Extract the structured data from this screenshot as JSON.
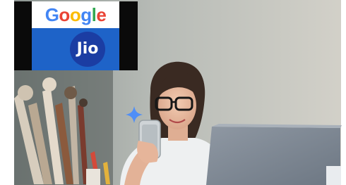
{
  "logo": {
    "google_text": "Google",
    "google_colors": [
      "#4285F4",
      "#EA4335",
      "#FBBC05",
      "#4285F4",
      "#34A853",
      "#EA4335"
    ],
    "jio_text": "Jio",
    "jio_circle_color": "#1b3da3",
    "panel_blue": "#1e63c8"
  },
  "scene": {
    "icons": [
      "gemini-sparkle-icon",
      "smartphone",
      "laptop",
      "paint-brushes"
    ]
  }
}
